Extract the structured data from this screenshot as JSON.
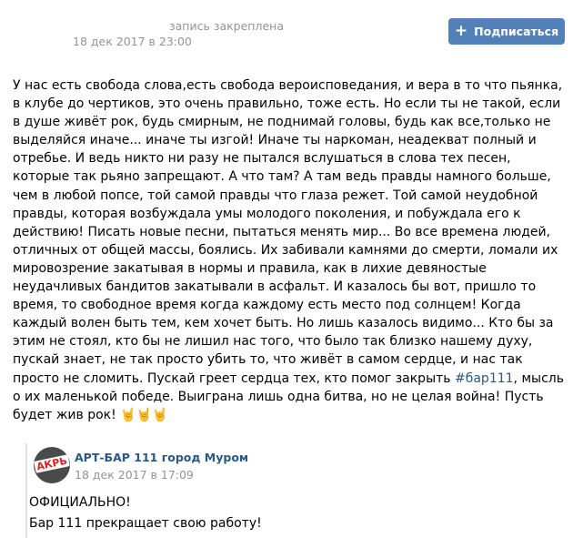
{
  "post": {
    "pinned_label": "запись закреплена",
    "date": "18 дек 2017 в 23:00",
    "subscribe_label": "Подписаться",
    "text_main": "У нас есть свобода слова,есть свобода вероисповедания, и вера в то что пьянка, в клубе до чертиков, это очень правильно, тоже есть. Но если ты не такой, если в душе живёт рок, будь смирным, не поднимай головы, будь как все,только не выделяйся иначе... иначе ты изгой! Иначе ты наркоман, неадекват полный и отребье. И ведь никто ни разу не пытался вслушаться в слова тех песен, которые так рьяно запрещают. А что там? А там ведь правды намного больше, чем в любой попсе, той самой правды что глаза режет. Той самой неудобной правды, которая возбуждала умы  молодого поколения, и побуждала его к действию! Писать новые песни, пытаться менять мир... Во все времена людей, отличных от общей массы, боялись. Их забивали камнями до смерти, ломали их мировозрение закатывая в нормы и правила, как в лихие девяностые неудачливых  бандитов закатывали в асфальт. И казалось бы вот, пришло то время, то свободное время когда каждому есть место под солнцем! Когда каждый волен быть тем, кем хочет быть. Но лишь казалось видимо... Кто бы за этим не стоял, кто бы не лишил нас того, что было так близко нашему духу, пускай знает, не так просто убить то, что живёт в самом сердце, и нас так просто не сломить. Пускай греет сердца тех, кто помог закрыть ",
    "hashtag": "#бар111",
    "text_end": ", мысль о их маленькой победе. Выиграна лишь одна битва, но не целая война! Пусть будет жив рок! ",
    "emojis": "🤘🤘🤘"
  },
  "repost": {
    "avatar_text": "АКРЬ",
    "author": "АРТ-БАР 111 город Муром",
    "date": "18 дек 2017 в 17:09",
    "line1": "ОФИЦИАЛЬНО!",
    "line2": "Бар 111 прекращает свою работу!"
  },
  "colors": {
    "accent": "#5181b8",
    "link": "#2a5885",
    "muted": "#939393",
    "repost_border": "#dae1e8"
  },
  "icons": {
    "subscribe": "plus-icon",
    "platform": "apple-icon"
  }
}
